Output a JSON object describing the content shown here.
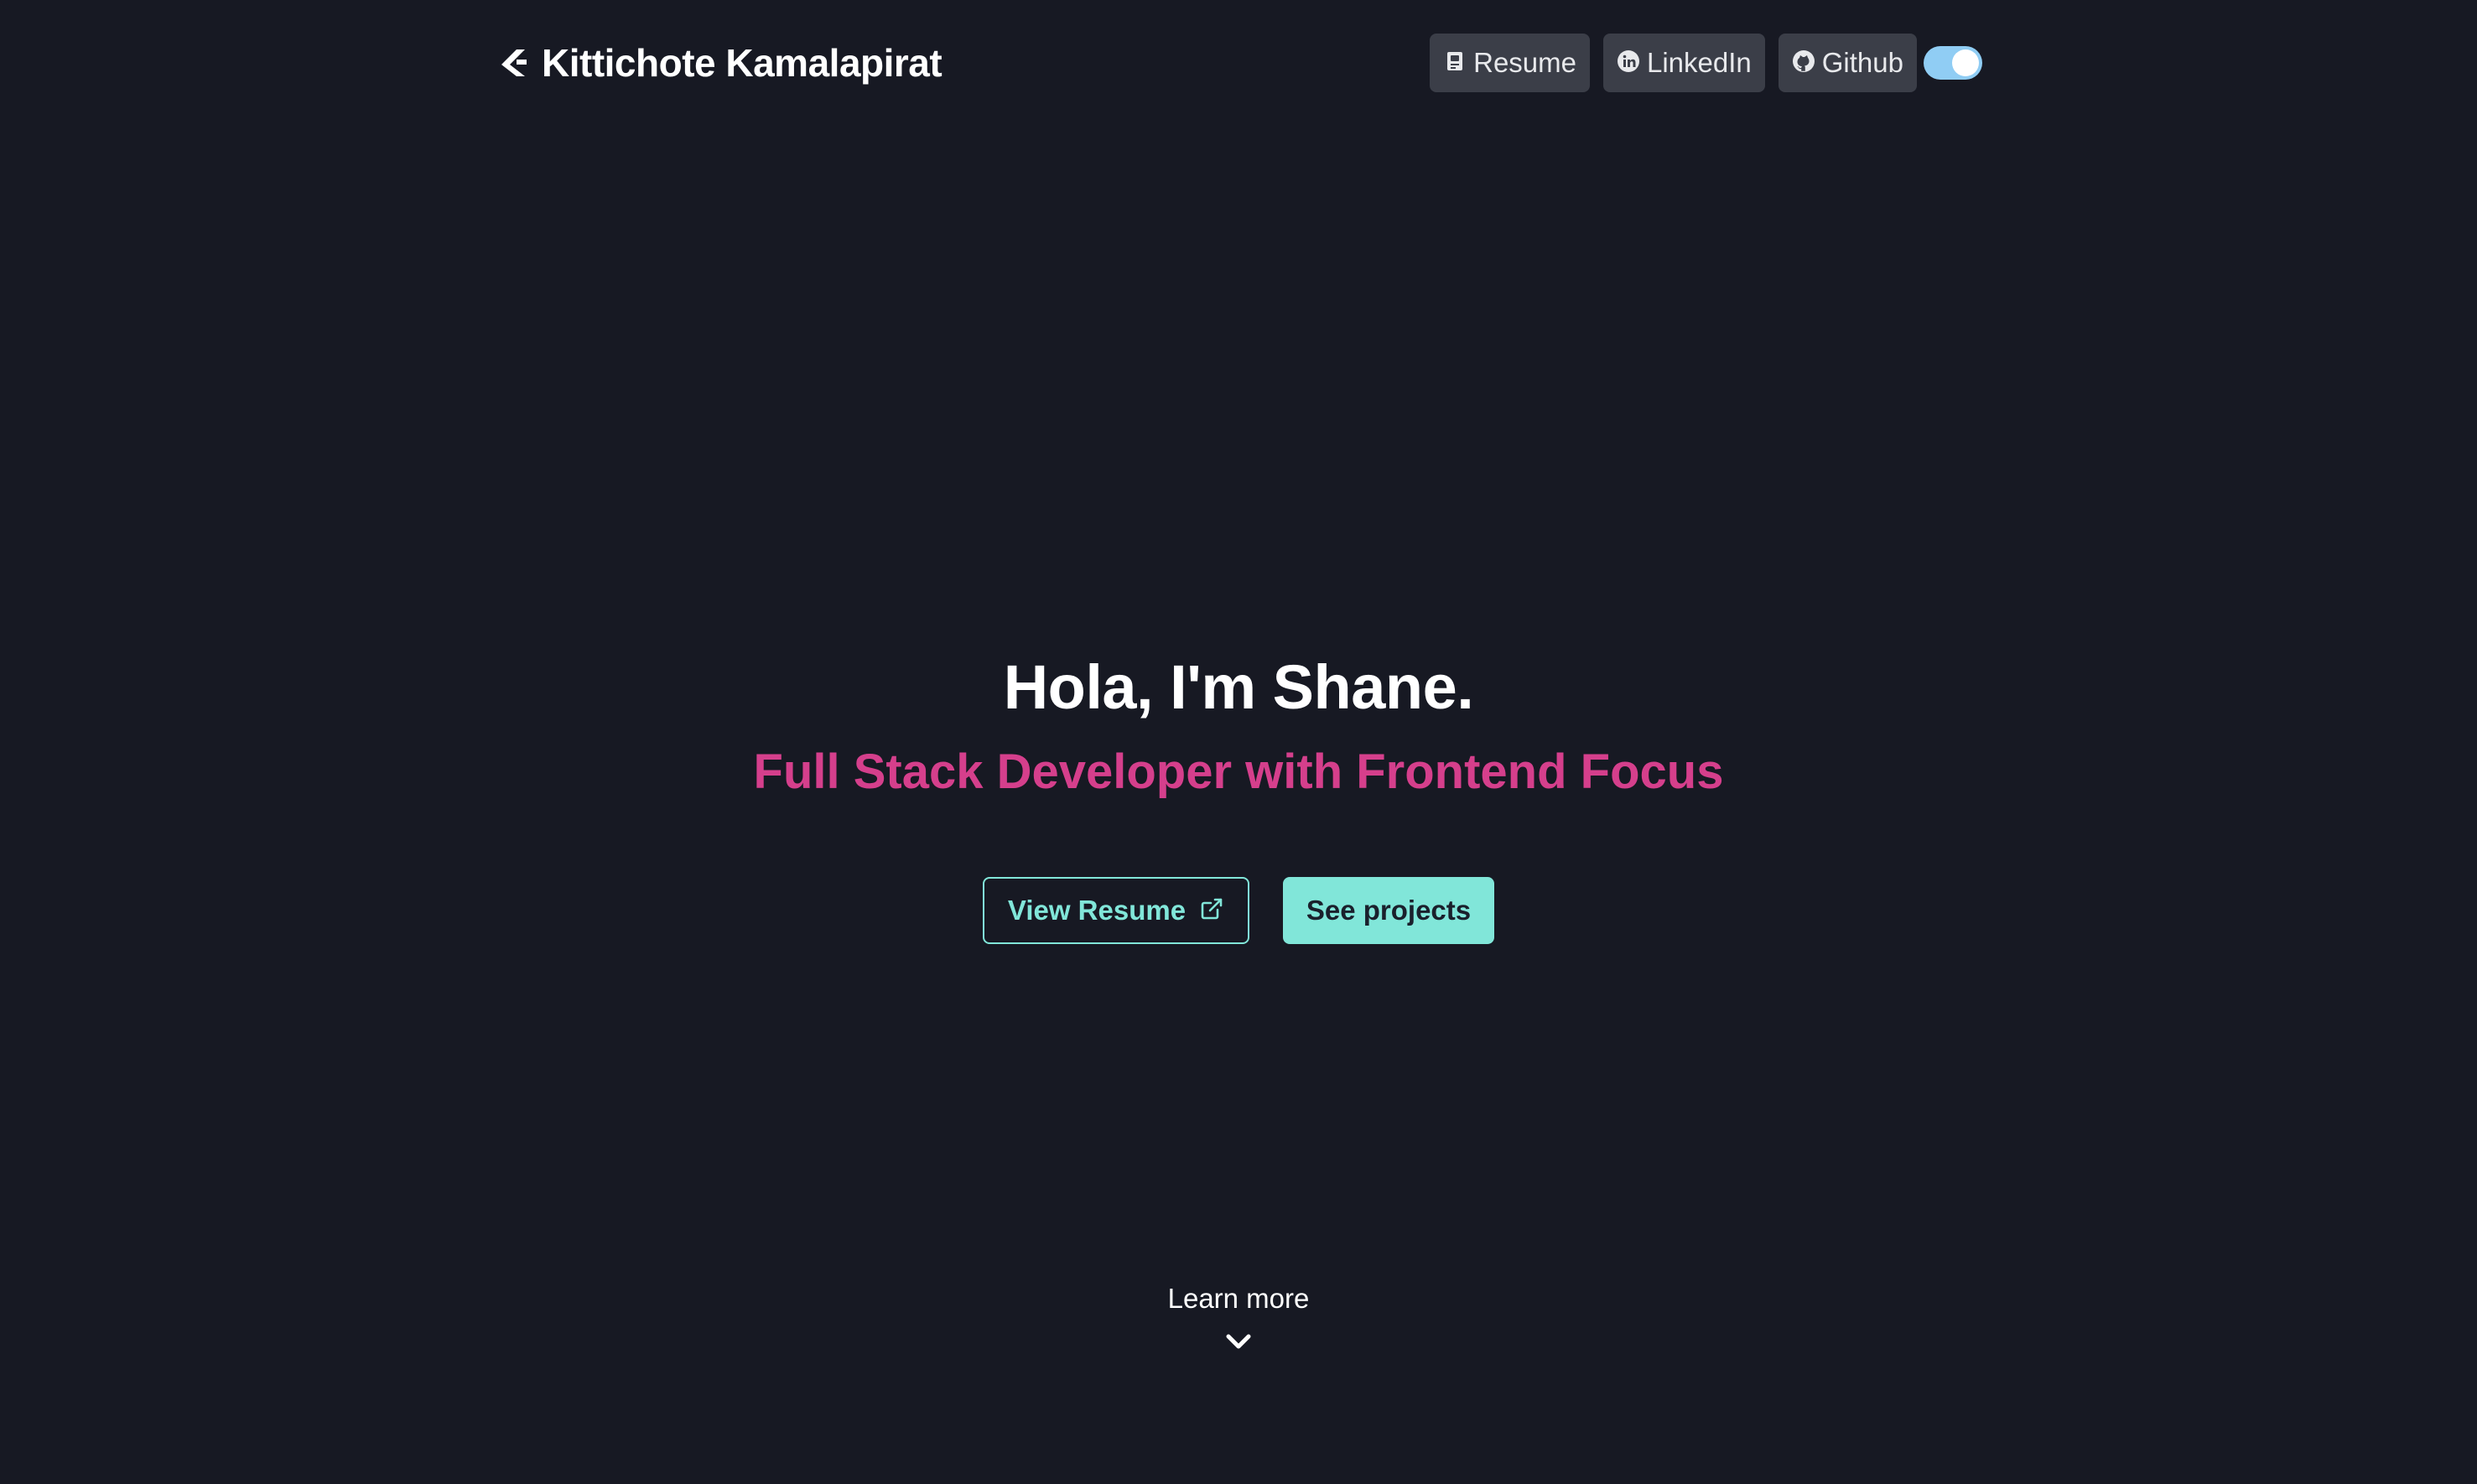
{
  "header": {
    "brand_name": "Kittichote Kamalapirat",
    "brand_icon": "chevron-logo-icon",
    "nav": [
      {
        "label": "Resume",
        "icon": "document-icon"
      },
      {
        "label": "LinkedIn",
        "icon": "linkedin-icon"
      },
      {
        "label": "Github",
        "icon": "github-icon"
      }
    ],
    "theme_toggle": {
      "state": "on",
      "color": "#90cdf4"
    }
  },
  "hero": {
    "title": "Hola, I'm Shane.",
    "subtitle": "Full Stack Developer with Frontend Focus",
    "subtitle_color": "#d53f8c",
    "primary_action": {
      "label": "View Resume",
      "icon": "external-link-icon"
    },
    "secondary_action": {
      "label": "See projects"
    },
    "accent_color": "#81e6d9"
  },
  "footer_hint": {
    "label": "Learn more",
    "icon": "chevron-down-icon"
  },
  "colors": {
    "background": "#171923",
    "nav_button": "#3b3e48"
  }
}
